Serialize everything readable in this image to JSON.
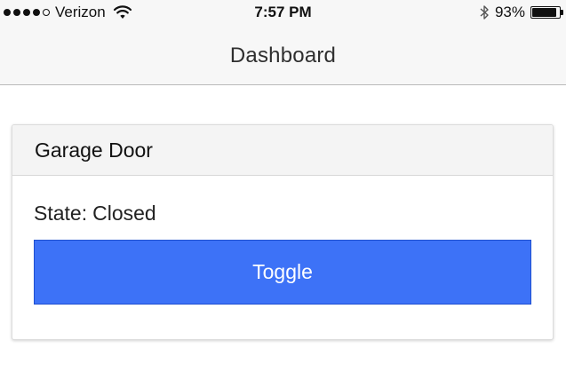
{
  "status_bar": {
    "carrier": "Verizon",
    "signal_bars_total": 5,
    "signal_bars_filled": 4,
    "time": "7:57 PM",
    "battery_percent_text": "93%",
    "battery_level": 0.93,
    "icons": {
      "wifi": "wifi-icon",
      "bluetooth": "bluetooth-icon",
      "battery": "battery-icon"
    }
  },
  "nav": {
    "title": "Dashboard"
  },
  "card": {
    "title": "Garage Door",
    "state_label": "State:",
    "state_value": "Closed",
    "toggle_label": "Toggle"
  },
  "colors": {
    "accent": "#3d72f7",
    "bar_background": "#f7f7f7",
    "card_header": "#f4f4f4"
  }
}
